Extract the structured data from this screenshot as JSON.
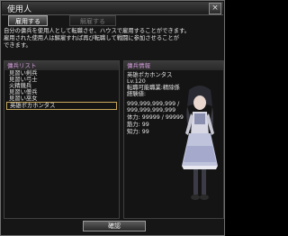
{
  "window": {
    "title": "使用人",
    "close_glyph": "×"
  },
  "tabs": [
    {
      "label": "雇用する",
      "active": true
    },
    {
      "label": "解雇する",
      "active": false
    }
  ],
  "description": [
    "自分の傭兵を使用人として転職させ、ハウスで雇用することができます。",
    "雇用された使用人は解雇すれば再び転職して戦闘に参加させることが",
    "できます。"
  ],
  "mercenary_list": {
    "header": "傭兵リスト",
    "items": [
      "見習い剣兵",
      "見習い弓士",
      "火精競兵",
      "見習い僧兵",
      "見習い巫女",
      "英雄ポカホンタス"
    ],
    "selected_index": 5
  },
  "mercenary_info": {
    "header": "傭兵情報",
    "lines": [
      "英雄ポカホンタス",
      "Lv.120",
      "転職可能職業:精除係",
      "経験値:",
      "999,999,999,999 /",
      "999,999,999,999",
      "体力: 99999 / 99999",
      "筋力: 99",
      "知力: 99"
    ]
  },
  "confirm_label": "確認",
  "colors": {
    "header_text": "#d19ad9",
    "selection_border": "#c8a85c"
  },
  "icons": {
    "close": "close-icon",
    "portrait": "character-portrait"
  }
}
